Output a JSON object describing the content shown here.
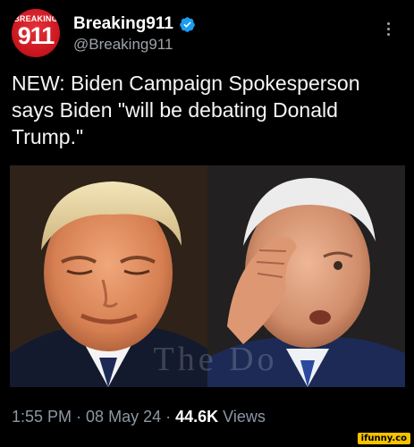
{
  "account": {
    "avatar_top_text": "BREAKING",
    "avatar_number": "911",
    "display_name": "Breaking911",
    "handle": "@Breaking911",
    "verified_icon": "verified-badge-icon",
    "verified_color": "#1d9bf0"
  },
  "tweet": {
    "text": "NEW: Biden Campaign Spokesperson says Biden \"will be debating Donald Trump.\""
  },
  "media": {
    "watermark": "The Do"
  },
  "meta": {
    "time": "1:55 PM",
    "sep1": " · ",
    "date": "08 May 24",
    "sep2": " · ",
    "views_count": "44.6K",
    "views_label": " Views"
  },
  "branding": {
    "ifunny": "ifunny.co"
  },
  "colors": {
    "background": "#000000",
    "secondary_text": "#8b98a5",
    "avatar_red": "#c8141d",
    "ifunny_yellow": "#f6c200"
  }
}
